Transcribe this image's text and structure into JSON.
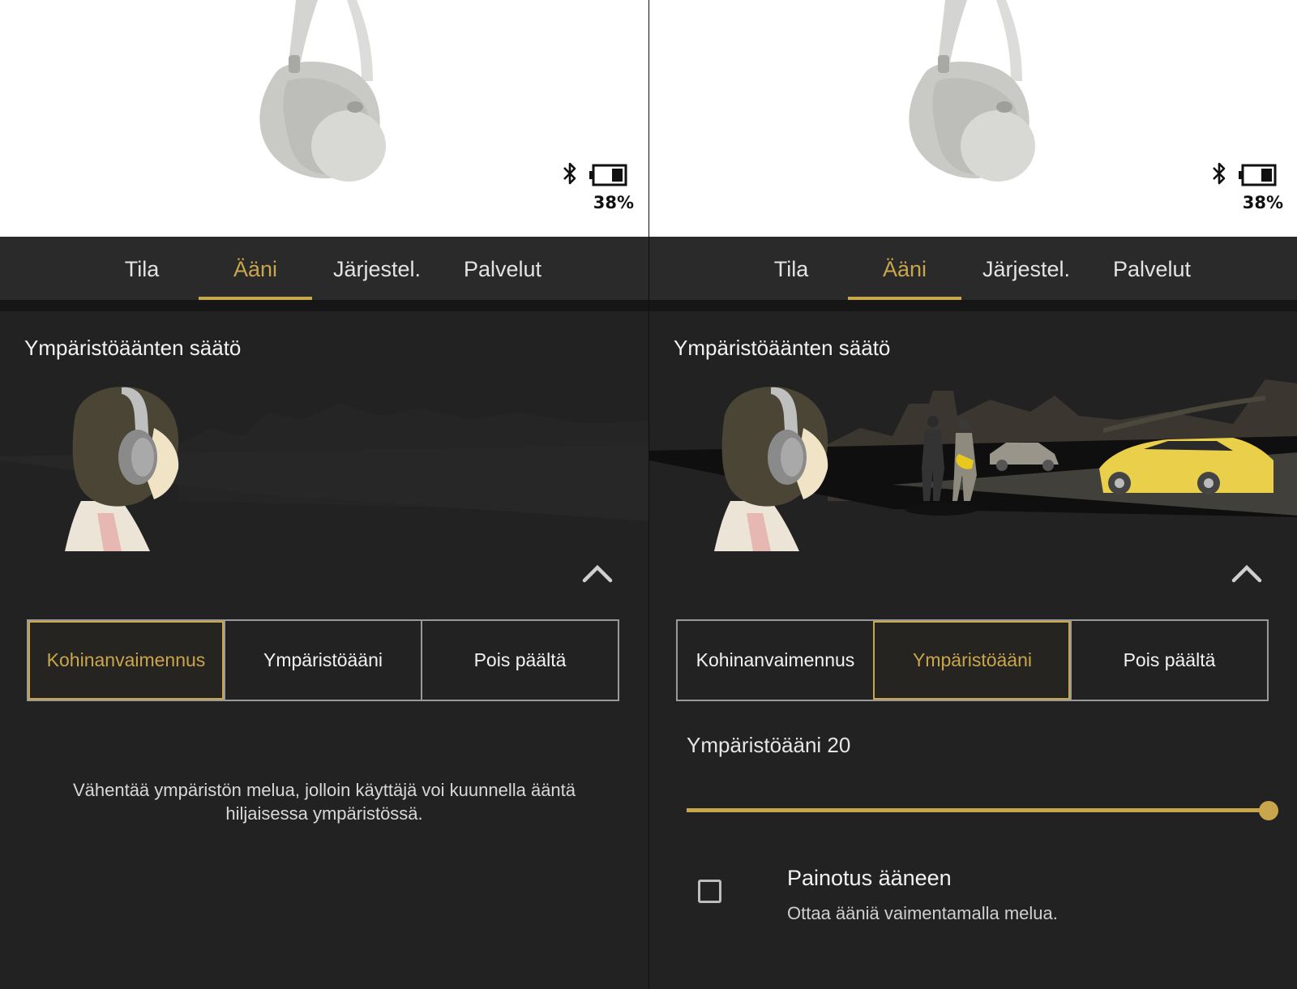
{
  "colors": {
    "accent": "#c9a54c",
    "background": "#222222",
    "tab_bar": "#2a2a2a",
    "hero": "#ffffff",
    "text": "#f2f2f2"
  },
  "icons": {
    "bluetooth": "bluetooth-icon",
    "battery": "battery-icon",
    "collapse": "chevron-up-icon",
    "checkbox": "checkbox-empty"
  },
  "panels": [
    {
      "battery": {
        "percent": "38%",
        "level": 0.38
      },
      "tabs": [
        "Tila",
        "Ääni",
        "Järjestel.",
        "Palvelut"
      ],
      "active_tab": "Ääni",
      "section_title": "Ympäristöäänten säätö",
      "modes": [
        "Kohinanvaimennus",
        "Ympäristöääni",
        "Pois päältä"
      ],
      "selected_mode": "Kohinanvaimennus",
      "description_line1": "Vähentää ympäristön melua, jolloin käyttäjä voi kuunnella ääntä",
      "description_line2": "hiljaisessa ympäristössä."
    },
    {
      "battery": {
        "percent": "38%",
        "level": 0.38
      },
      "tabs": [
        "Tila",
        "Ääni",
        "Järjestel.",
        "Palvelut"
      ],
      "active_tab": "Ääni",
      "section_title": "Ympäristöäänten säätö",
      "modes": [
        "Kohinanvaimennus",
        "Ympäristöääni",
        "Pois päältä"
      ],
      "selected_mode": "Ympäristöääni",
      "ambient_level_label": "Ympäristöääni 20",
      "ambient_slider": {
        "value": 20,
        "max": 20
      },
      "voice_focus": {
        "title": "Painotus ääneen",
        "subtitle": "Ottaa ääniä vaimentamalla melua.",
        "checked": false
      }
    }
  ]
}
